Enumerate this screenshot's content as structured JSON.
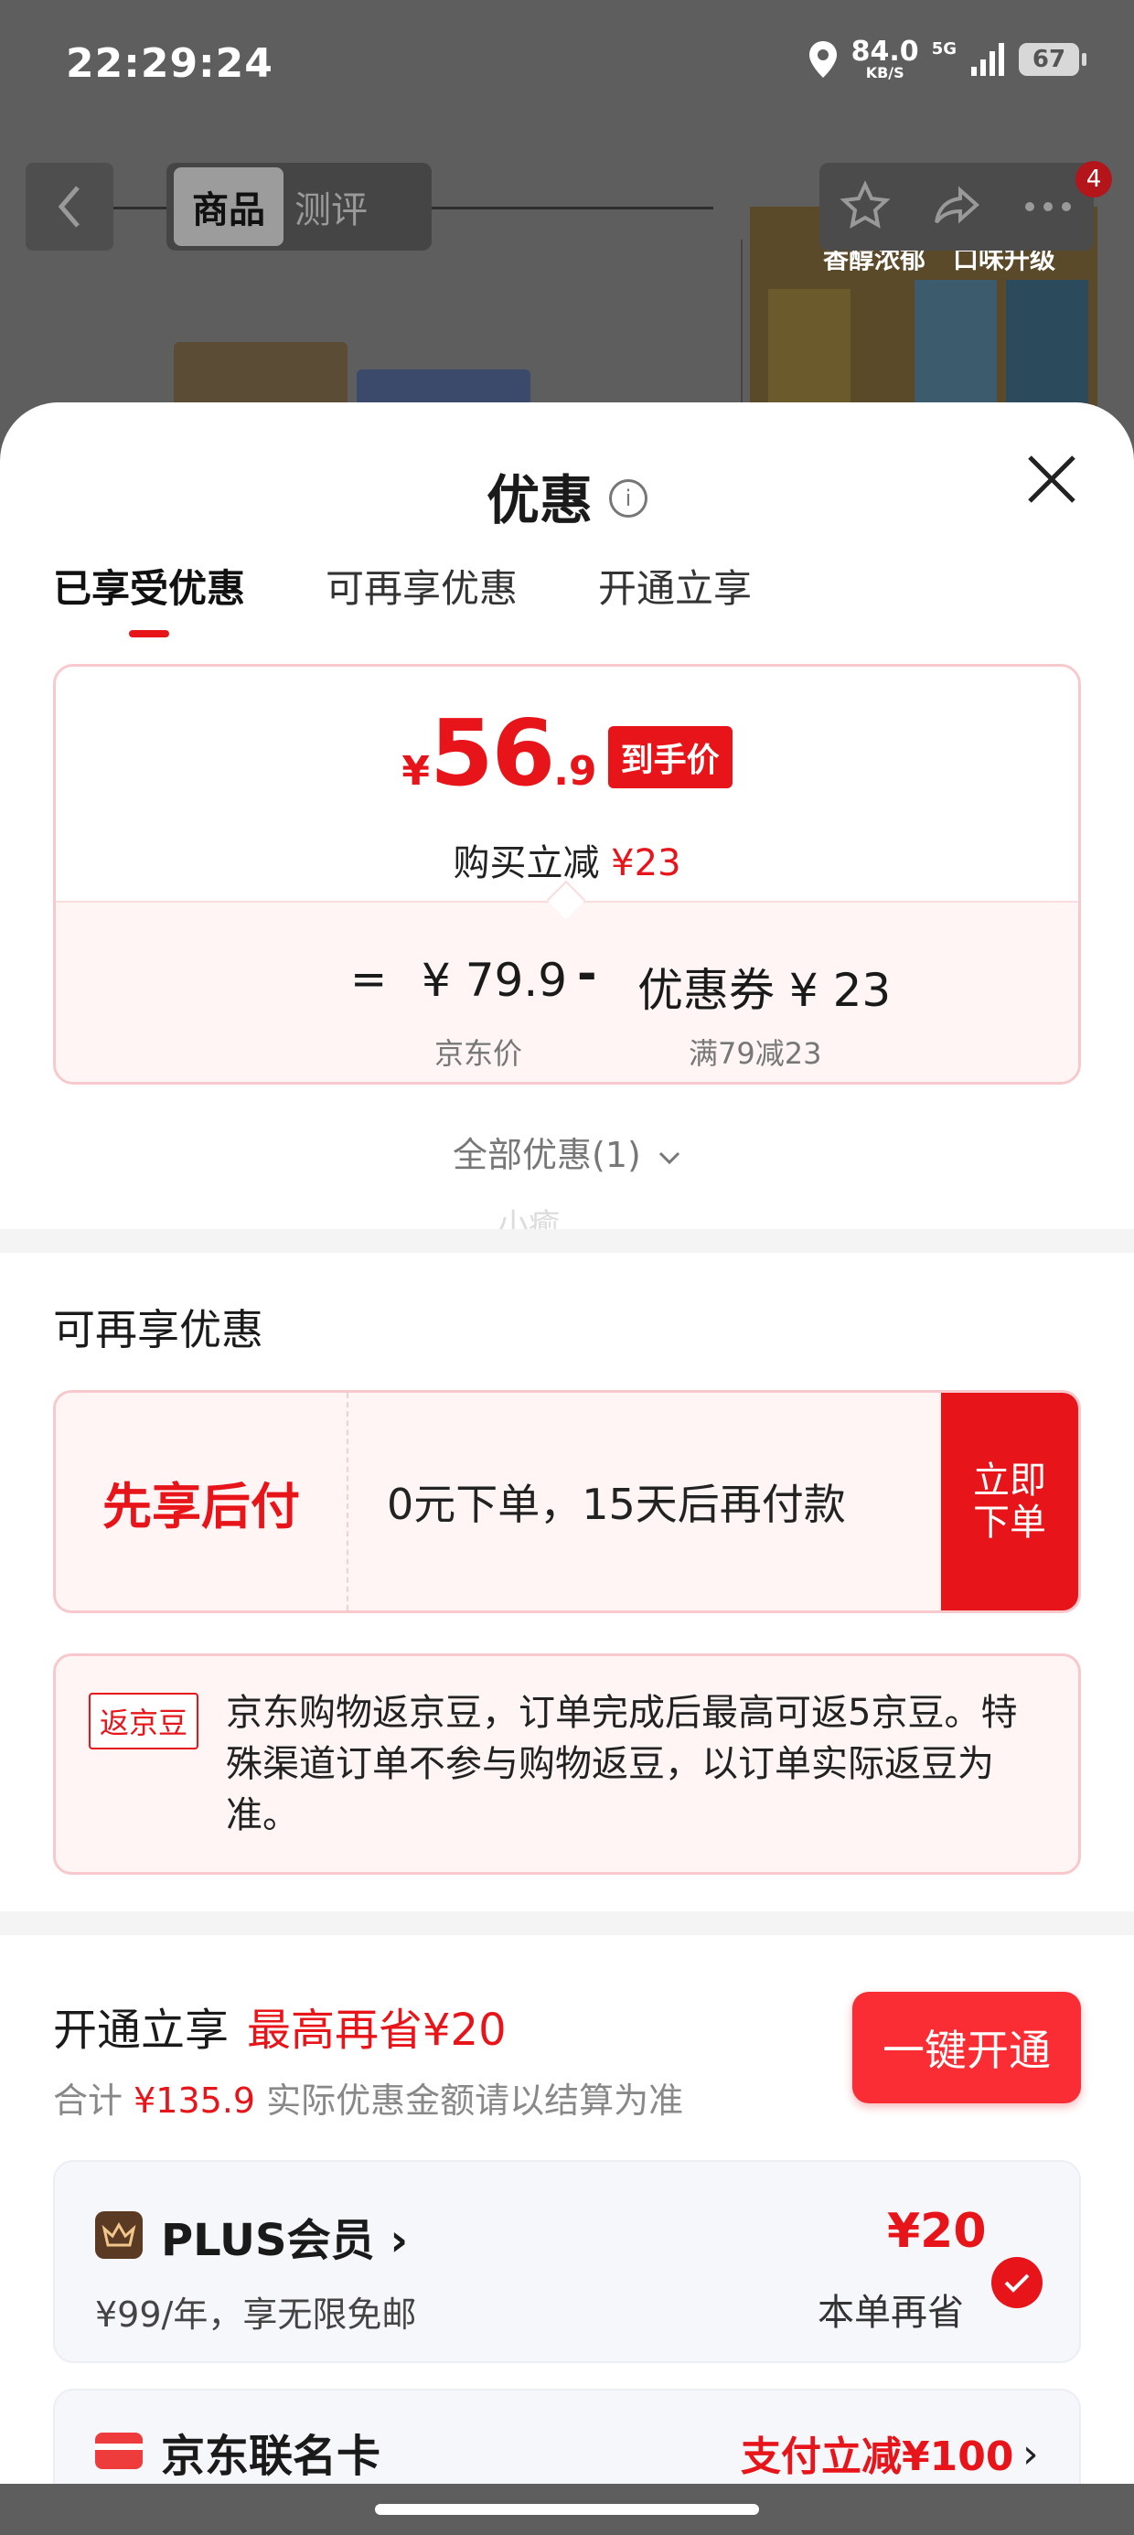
{
  "status_bar": {
    "time": "22:29:24",
    "speed": "84.0",
    "speed_unit": "KB/S",
    "network": "5G",
    "battery": "67"
  },
  "background": {
    "tab_product": "商品",
    "tab_review": "测评",
    "cart_badge": "4",
    "product_caption_1": "香醇浓郁",
    "product_caption_2": "口味升级"
  },
  "sheet": {
    "title": "优惠",
    "tabs": [
      {
        "label": "已享受优惠",
        "active": true
      },
      {
        "label": "可再享优惠",
        "active": false
      },
      {
        "label": "开通立享",
        "active": false
      }
    ],
    "price": {
      "currency": "¥",
      "integer": "56",
      "decimal": ".9",
      "tag": "到手价",
      "sub_prefix": "购买立减",
      "sub_amount": "¥23"
    },
    "formula": {
      "equals": "=",
      "jd_price": "¥ 79.9",
      "minus": "-",
      "coupon": "优惠券 ¥ 23",
      "jd_price_label": "京东价",
      "coupon_label": "满79减23"
    },
    "all_offers": "全部优惠(1)",
    "watermark": "小癒"
  },
  "more_offers": {
    "title": "可再享优惠",
    "bnpl": {
      "label": "先享后付",
      "desc": "0元下单，15天后再付款",
      "button": "立即下单"
    },
    "jd_bean": {
      "tag": "返京豆",
      "text": "京东购物返京豆，订单完成后最高可返5京豆。特殊渠道订单不参与购物返豆，以订单实际返豆为准。"
    }
  },
  "open_now": {
    "title": "开通立享",
    "highlight": "最高再省¥20",
    "sub_prefix": "合计",
    "sub_amount": "¥135.9",
    "sub_suffix": "实际优惠金额请以结算为准",
    "button": "一键开通",
    "plus": {
      "name": "PLUS会员",
      "chevron": "›",
      "desc": "¥99/年，享无限免邮",
      "save": "¥20",
      "save_label": "本单再省",
      "checked": true
    },
    "card": {
      "name": "京东联名卡",
      "promo": "支付立减¥100",
      "chevron": "›"
    }
  },
  "colors": {
    "accent": "#e7141a",
    "accent_bg": "#fff5f5",
    "border": "#f7c9cd"
  }
}
